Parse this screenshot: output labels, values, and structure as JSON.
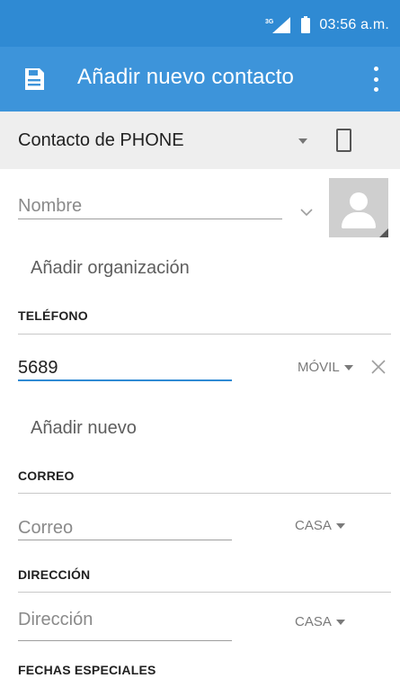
{
  "status_bar": {
    "network": "3G",
    "time": "03:56 a.m."
  },
  "app_bar": {
    "title": "Añadir nuevo contacto",
    "icon": "save-icon",
    "menu_icon": "overflow-menu-icon"
  },
  "account": {
    "label": "Contacto de PHONE",
    "device_icon": "phone-icon"
  },
  "name": {
    "placeholder": "Nombre"
  },
  "organization": {
    "label": "Añadir organización"
  },
  "phone_section": {
    "header": "TELÉFONO",
    "value": "5689",
    "type": "MÓVIL",
    "add_new": "Añadir nuevo"
  },
  "email_section": {
    "header": "CORREO",
    "placeholder": "Correo",
    "type": "CASA"
  },
  "address_section": {
    "header": "DIRECCIÓN",
    "placeholder": "Dirección",
    "type": "CASA"
  },
  "special_dates": {
    "header": "FECHAS ESPECIALES"
  },
  "colors": {
    "status_bar": "#2f8ad3",
    "app_bar": "#3d94da",
    "accent": "#2f8ad3",
    "account_bar": "#eeeeee"
  }
}
